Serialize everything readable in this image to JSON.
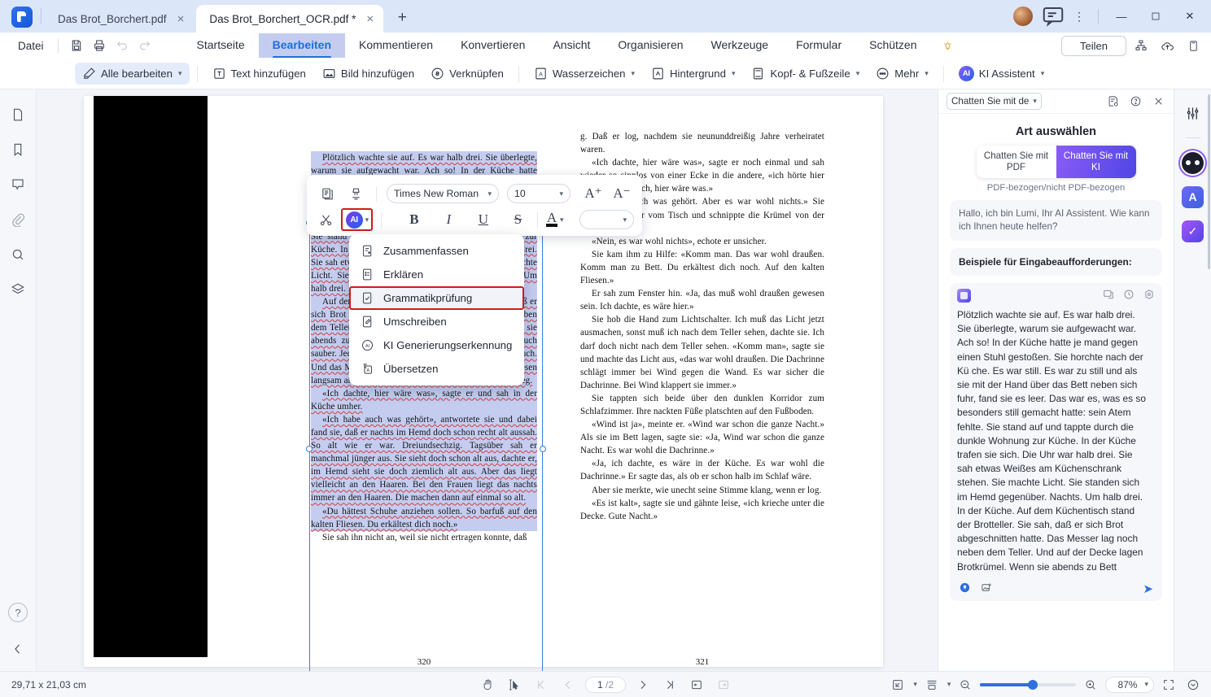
{
  "window": {
    "tabs": [
      {
        "title": "Das Brot_Borchert.pdf",
        "close": "×",
        "active": false
      },
      {
        "title": "Das Brot_Borchert_OCR.pdf *",
        "close": "×",
        "active": true
      }
    ],
    "new_tab": "+",
    "minimize": "—",
    "maximize": "☐",
    "close": "✕",
    "more": "⋮"
  },
  "menu": {
    "file_label": "Datei",
    "tabs": [
      "Startseite",
      "Bearbeiten",
      "Kommentieren",
      "Konvertieren",
      "Ansicht",
      "Organisieren",
      "Werkzeuge",
      "Formular",
      "Schützen"
    ],
    "selected_tab": "Bearbeiten",
    "share_label": "Teilen"
  },
  "ribbon": {
    "items": [
      {
        "label": "Alle bearbeiten",
        "caret": true,
        "highlight": true
      },
      {
        "label": "Text hinzufügen",
        "caret": false
      },
      {
        "label": "Bild hinzufügen",
        "caret": false
      },
      {
        "label": "Verknüpfen",
        "caret": false
      },
      {
        "label": "Wasserzeichen",
        "caret": true
      },
      {
        "label": "Hintergrund",
        "caret": true
      },
      {
        "label": "Kopf- & Fußzeile",
        "caret": true
      },
      {
        "label": "Mehr",
        "caret": true
      },
      {
        "label": "KI Assistent",
        "caret": true
      }
    ],
    "ai_badge": "AI"
  },
  "float_toolbar": {
    "font_family": "Times New Roman",
    "font_size": "10",
    "grow_label": "A⁺",
    "shrink_label": "A⁻",
    "bold": "B",
    "italic": "I",
    "underline": "U",
    "strike": "S",
    "font_color_label": "A",
    "ai_badge": "AI",
    "highlight_value": ""
  },
  "ai_menu": {
    "items": [
      {
        "label": "Zusammenfassen",
        "icon": "summarize-icon",
        "highlighted": false
      },
      {
        "label": "Erklären",
        "icon": "explain-icon",
        "highlighted": false
      },
      {
        "label": "Grammatikprüfung",
        "icon": "grammar-check-icon",
        "highlighted": true
      },
      {
        "label": "Umschreiben",
        "icon": "rewrite-icon",
        "highlighted": false
      },
      {
        "label": "KI Generierungserkennung",
        "icon": "ai-detect-icon",
        "highlighted": false
      },
      {
        "label": "Übersetzen",
        "icon": "translate-icon",
        "highlighted": false
      }
    ]
  },
  "document": {
    "left_page_number": "320",
    "right_page_number": "321",
    "left_column": {
      "p1": "Plötzlich wachte sie auf. Es war halb drei. Sie überlegte, warum sie aufgewacht war. Ach so! In der Küche hatte jemand gegen einen Stuhl gestoßen. Sie horchte nach der Küche. Es war still. Es war zu still und als sie mit der Hand über das Bett neben sich fuhr, fand sie es leer. Das war es, was es so besonders still gemacht hatte: sein Atem fehlte. Sie stand auf und tappte durch die dunkle Wohnung zur Küche. In der Küche trafen sie sich. Die Uhr war halb drei. Sie sah etwas Weißes am Küchenschrank stehen. Sie machte Licht. Sie standen sich im Hemd gegenüber. Nachts. Um halb drei. In der Küche.",
      "p2": "Auf dem Küchentisch stand der Brotteller. Sie sah, daß er sich Brot abgeschnitten hatte. Das Messer lag noch neben dem Teller. Und auf der Decke lagen Brotkrümel. Wenn sie abends zu Bett gingen, machte sie immer das Tischtuch sauber. Jeden Abend. Aber nun lagen Krümel auf dem Tuch. Und das Messer lag da. Sie fühlte, wie die Kälte der Fliesen langsam an ihr hochkroch. Und sie sah von dem Teller weg.",
      "p3": "«Ich dachte, hier wäre was», sagte er und sah in der Küche umher.",
      "p4": "«Ich habe auch was gehört», antwortete sie und dabei fand sie, daß er nachts im Hemd doch schon recht alt aussah. So alt wie er war. Dreiundsechzig. Tagsüber sah er manchmal jünger aus. Sie sieht doch schon alt aus, dachte er, im Hemd sieht sie doch ziemlich alt aus. Aber das liegt vielleicht an den Haaren. Bei den Frauen liegt das nachts immer an den Haaren. Die machen dann auf einmal so alt.",
      "p5": "«Du hättest Schuhe anziehen sollen. So barfuß auf den kalten Fliesen. Du erkältest dich noch.»",
      "p6": "Sie sah ihn nicht an, weil sie nicht ertragen konnte, daß"
    },
    "right_column": {
      "p0": "g. Daß er log, nachdem sie neununddreißig Jahre verheiratet waren.",
      "p1": "«Ich dachte, hier wäre was», sagte er noch einmal und sah wieder so sinnlos von einer Ecke in die andere, «ich hörte hier was. Da dachte ich, hier wäre was.»",
      "p2": "«Ich hab auch was gehört. Aber es war wohl nichts.» Sie stellte den Teller vom Tisch und schnippte die Krümel von der Decke.",
      "p3": "«Nein, es war wohl nichts», echote er unsicher.",
      "p4": "Sie kam ihm zu Hilfe: «Komm man. Das war wohl draußen. Komm man zu Bett. Du erkältest dich noch. Auf den kalten Fliesen.»",
      "p5": "Er sah zum Fenster hin. «Ja, das muß wohl draußen gewesen sein. Ich dachte, es wäre hier.»",
      "p6": "Sie hob die Hand zum Lichtschalter. Ich muß das Licht jetzt ausmachen, sonst muß ich nach dem Teller sehen, dachte sie. Ich darf doch nicht nach dem Teller sehen. «Komm man», sagte sie und machte das Licht aus, «das war wohl draußen. Die Dachrinne schlägt immer bei Wind gegen die Wand. Es war sicher die Dachrinne. Bei Wind klappert sie immer.»",
      "p7": "Sie tappten sich beide über den dunklen Korridor zum Schlafzimmer. Ihre nackten Füße platschten auf den Fußboden.",
      "p8": "«Wind ist ja», meinte er. «Wind war schon die ganze Nacht.» Als sie im Bett lagen, sagte sie: «Ja, Wind war schon die ganze Nacht. Es war wohl die Dachrinne.»",
      "p9": "«Ja, ich dachte, es wäre in der Küche. Es war wohl die Dachrinne.» Er sagte das, als ob er schon halb im Schlaf wäre.",
      "p10": "Aber sie merkte, wie unecht seine Stimme klang, wenn er log.",
      "p11": "«Es ist kalt», sagte sie und gähnte leise, «ich krieche unter die Decke. Gute Nacht.»"
    }
  },
  "ai_panel": {
    "mode_selector": "Chatten Sie mit de",
    "title": "Art auswählen",
    "segment_left": "Chatten Sie mit PDF",
    "segment_right": "Chatten Sie mit KI",
    "segment_selected": "Chatten Sie mit KI",
    "segment_note": "PDF-bezogen/nicht PDF-bezogen",
    "greeting": "Hallo, ich bin Lumi, Ihr AI Assistent. Wie kann ich Ihnen heute helfen?",
    "examples_title": "Beispiele für Eingabeaufforderungen:",
    "prompt_text": "Plötzlich wachte sie auf. Es war halb drei. Sie überlegte, warum sie aufgewacht war. Ach so! In der Küche hatte je mand gegen einen Stuhl gestoßen. Sie horchte nach der Kü che. Es war still. Es war zu still und als sie mit der Hand über das Bett neben sich fuhr, fand sie es leer. Das war es, was es so besonders still gemacht hatte: sein Atem fehlte. Sie stand auf und tappte durch die dunkle Wohnung zur Küche. In der Küche trafen sie sich. Die Uhr war halb drei. Sie sah etwas Weißes am Küchenschrank stehen. Sie machte Licht. Sie standen sich im Hemd gegenüber. Nachts. Um halb drei. In der Küche.\nAuf dem Küchentisch stand der Brotteller. Sie sah, daß er sich Brot abgeschnitten hatte. Das Messer lag noch neben dem Teller. Und auf der Decke lagen Brotkrümel. Wenn sie abends zu Bett gingen, machte sie immer das Tischtuch sauber. Jeden Abend. Aber nun lagen Krümel auf dem Tuch. Und das Messer lag da. Sie fühlte, wie die Kälte der Fliesen langsam an ihr hochkroch. Und sie sah von dem Teller weg. «Ich dachte, hier wäre was», sagte er und sah in der Kü che umher."
  },
  "status_bar": {
    "dimensions": "29,71 x 21,03 cm",
    "page_current": "1",
    "page_total": "/2",
    "zoom_level": "87%"
  },
  "colors": {
    "accent": "#2f6fe0",
    "titlebar": "#dce6f9",
    "highlight_red": "#c81e1e",
    "ai_purple": "#7c3aed",
    "selection": "#c4cdf0"
  }
}
